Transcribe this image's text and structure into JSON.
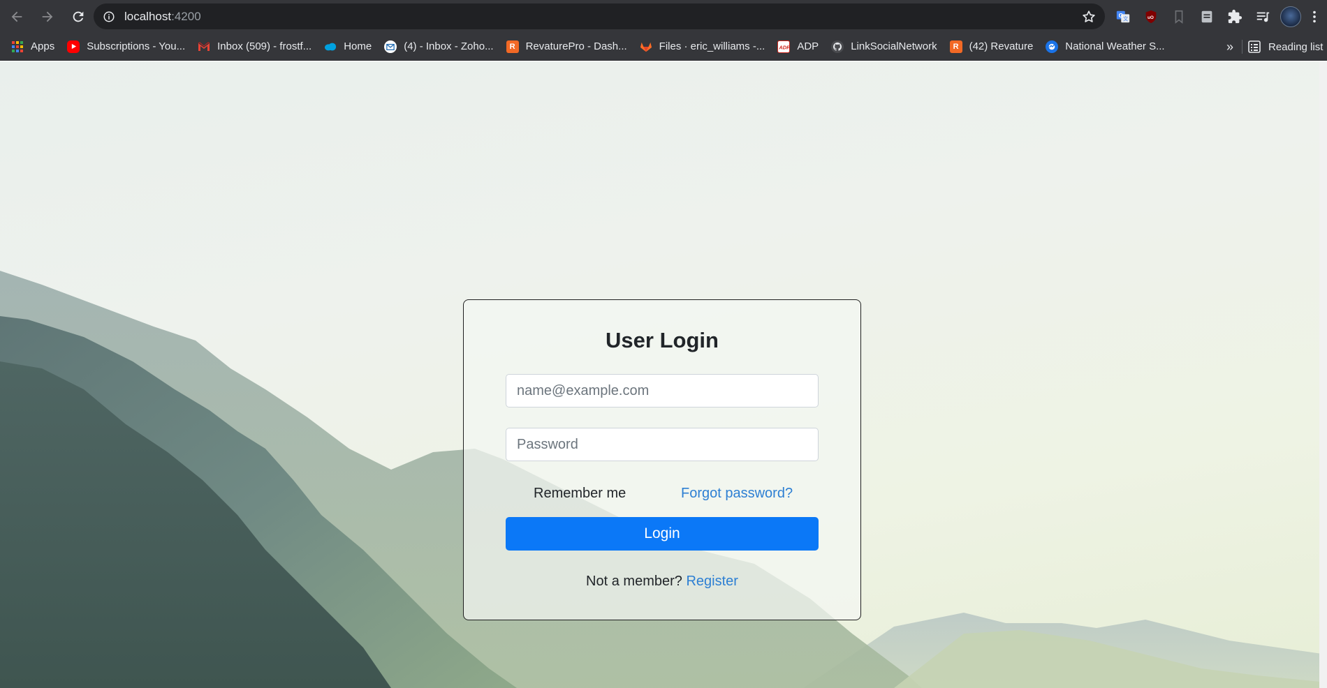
{
  "browser": {
    "url_host": "localhost",
    "url_port": ":4200",
    "bookmarks": [
      {
        "label": "Apps",
        "icon": "apps-grid-icon",
        "color": "#ea4335"
      },
      {
        "label": "Subscriptions - You...",
        "icon": "youtube-icon",
        "color": "#ff0000"
      },
      {
        "label": "Inbox (509) - frostf...",
        "icon": "gmail-icon",
        "color": "#ea4335"
      },
      {
        "label": "Home",
        "icon": "salesforce-cloud-icon",
        "color": "#00a1e0"
      },
      {
        "label": "(4) - Inbox - Zoho...",
        "icon": "zoho-mail-icon",
        "color": "#e8eaed"
      },
      {
        "label": "RevaturePro - Dash...",
        "icon": "revature-icon",
        "color": "#f26925"
      },
      {
        "label": "Files · eric_williams -...",
        "icon": "gitlab-icon",
        "color": "#fc6d26"
      },
      {
        "label": "ADP",
        "icon": "adp-icon",
        "color": "#d0271d"
      },
      {
        "label": "LinkSocialNetwork",
        "icon": "github-icon",
        "color": "#e8eaed"
      },
      {
        "label": "(42) Revature",
        "icon": "revature-icon",
        "color": "#f26925"
      },
      {
        "label": "National Weather S...",
        "icon": "nws-icon",
        "color": "#1a73e8"
      }
    ],
    "more_label": "»",
    "reading_list_label": "Reading list"
  },
  "login": {
    "title": "User Login",
    "email_placeholder": "name@example.com",
    "password_placeholder": "Password",
    "remember_label": "Remember me",
    "forgot_label": "Forgot password?",
    "login_button": "Login",
    "member_text": "Not a member?",
    "register_label": "Register"
  },
  "colors": {
    "primary": "#0b78f7",
    "link": "#2d7fd3",
    "chrome_bg": "#35363a"
  }
}
